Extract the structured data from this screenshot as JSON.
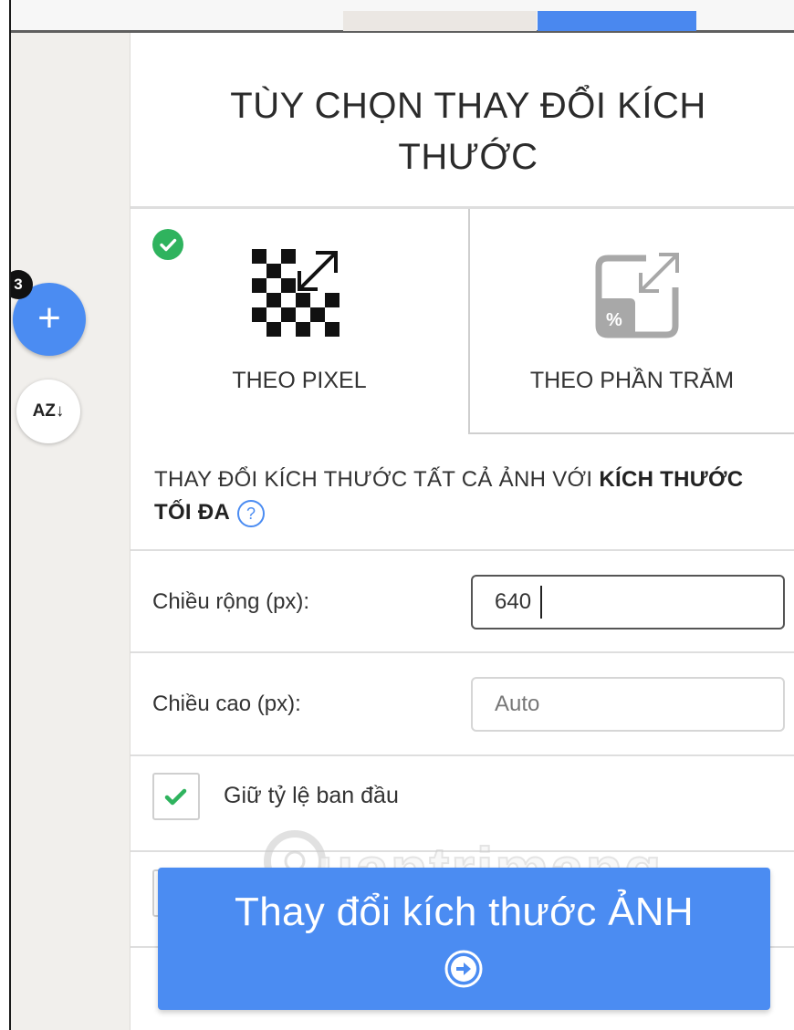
{
  "sidebar": {
    "badge_count": "3",
    "add_label": "+",
    "sort_label": "AZ↓"
  },
  "panel": {
    "title": "TÙY CHỌN THAY ĐỔI KÍCH THƯỚC",
    "modes": [
      {
        "label": "THEO PIXEL",
        "selected": true,
        "icon": "pixel-resize-icon"
      },
      {
        "label": "THEO PHẦN TRĂM",
        "selected": false,
        "icon": "percent-resize-icon"
      }
    ],
    "description_prefix": "THAY ĐỔI KÍCH THƯỚC TẤT CẢ ẢNH VỚI ",
    "description_bold": "KÍCH THƯỚC TỐI ĐA",
    "help_symbol": "?",
    "width_label": "Chiều rộng (px):",
    "width_value": "640",
    "height_label": "Chiều cao (px):",
    "height_placeholder": "Auto",
    "keep_ratio_label": "Giữ tỷ lệ ban đầu",
    "keep_ratio_checked": true
  },
  "cta": {
    "label": "Thay đổi kích thước ẢNH",
    "icon": "arrow-right-circle-icon"
  },
  "watermark": {
    "text": "uantrimang"
  },
  "colors": {
    "accent": "#4b8cf2",
    "check_green": "#2fb35e",
    "sidebar_bg": "#f1efec"
  }
}
